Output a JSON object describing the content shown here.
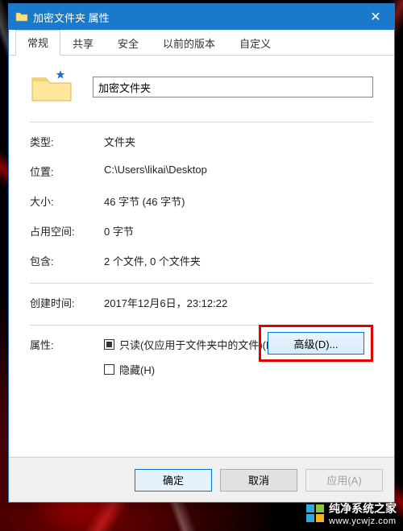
{
  "window": {
    "title": "加密文件夹 属性",
    "close_glyph": "✕"
  },
  "tabs": [
    "常规",
    "共享",
    "安全",
    "以前的版本",
    "自定义"
  ],
  "active_tab_index": 0,
  "folder": {
    "name": "加密文件夹"
  },
  "props": {
    "type_label": "类型:",
    "type_value": "文件夹",
    "location_label": "位置:",
    "location_value": "C:\\Users\\likai\\Desktop",
    "size_label": "大小:",
    "size_value": "46 字节 (46 字节)",
    "sizeondisk_label": "占用空间:",
    "sizeondisk_value": "0 字节",
    "contains_label": "包含:",
    "contains_value": "2 个文件, 0 个文件夹",
    "created_label": "创建时间:",
    "created_value": "2017年12月6日，23:12:22"
  },
  "attributes": {
    "section_label": "属性:",
    "readonly_label": "只读(仅应用于文件夹中的文件)(R)",
    "readonly_state": "indeterminate",
    "hidden_label": "隐藏(H)",
    "hidden_state": "unchecked",
    "advanced_label": "高级(D)..."
  },
  "buttons": {
    "ok": "确定",
    "cancel": "取消",
    "apply": "应用(A)"
  },
  "watermark": {
    "brand": "纯净系统之家",
    "url": "www.ycwjz.com",
    "colors": [
      "#2fa8e0",
      "#8bc540",
      "#2fa8e0",
      "#f5b417"
    ]
  }
}
